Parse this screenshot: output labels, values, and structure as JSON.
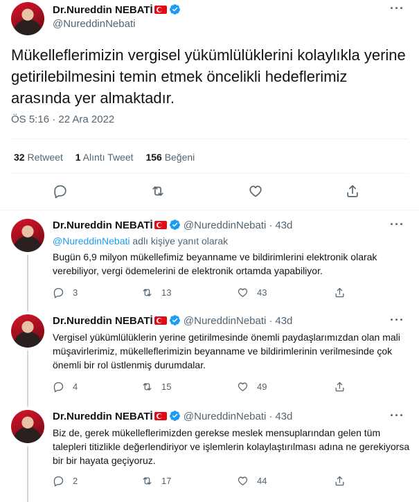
{
  "main_tweet": {
    "author_name": "Dr.Nureddin NEBATİ",
    "author_handle": "@NureddinNebati",
    "text": "Mükelleflerimizin vergisel yükümlülüklerini kolaylıkla yerine getirilebilmesini temin etmek öncelikli hedeflerimiz arasında yer almaktadır.",
    "timestamp": "ÖS 5:16 · 22 Ara 2022",
    "stats": [
      {
        "count": "32",
        "label": "Retweet"
      },
      {
        "count": "1",
        "label": "Alıntı Tweet"
      },
      {
        "count": "156",
        "label": "Beğeni"
      }
    ],
    "more_label": "···"
  },
  "replies": [
    {
      "author_name": "Dr.Nureddin NEBATİ",
      "author_handle": "@NureddinNebati",
      "age": "43d",
      "reply_to_link": "@NureddinNebati",
      "reply_to_suffix": " adlı kişiye yanıt olarak",
      "text": "Bugün 6,9 milyon mükellefimiz beyanname ve bildirimlerini elektronik olarak verebiliyor, vergi ödemelerini de elektronik ortamda yapabiliyor.",
      "replies": "3",
      "retweets": "13",
      "likes": "43"
    },
    {
      "author_name": "Dr.Nureddin NEBATİ",
      "author_handle": "@NureddinNebati",
      "age": "43d",
      "text": "Vergisel yükümlülüklerin yerine getirilmesinde önemli paydaşlarımızdan olan mali müşavirlerimiz, mükelleflerimizin beyanname ve bildirimlerinin verilmesinde çok önemli bir rol üstlenmiş durumdalar.",
      "replies": "4",
      "retweets": "15",
      "likes": "49"
    },
    {
      "author_name": "Dr.Nureddin NEBATİ",
      "author_handle": "@NureddinNebati",
      "age": "43d",
      "text": "Biz de, gerek mükelleflerimizden gerekse meslek mensuplarından gelen tüm talepleri titizlikle değerlendiriyor ve işlemlerin kolaylaştırılması adına ne gerekiyorsa bir bir hayata geçiyoruz.",
      "replies": "2",
      "retweets": "17",
      "likes": "44"
    }
  ],
  "icons": {
    "verified": "verified-badge-icon",
    "flag": "turkey-flag-icon",
    "reply": "reply-icon",
    "retweet": "retweet-icon",
    "like": "heart-icon",
    "share": "share-icon"
  },
  "colors": {
    "link": "#1d9bf0",
    "secondary": "#536471",
    "primary": "#0f1419",
    "divider": "#eff3f4"
  }
}
